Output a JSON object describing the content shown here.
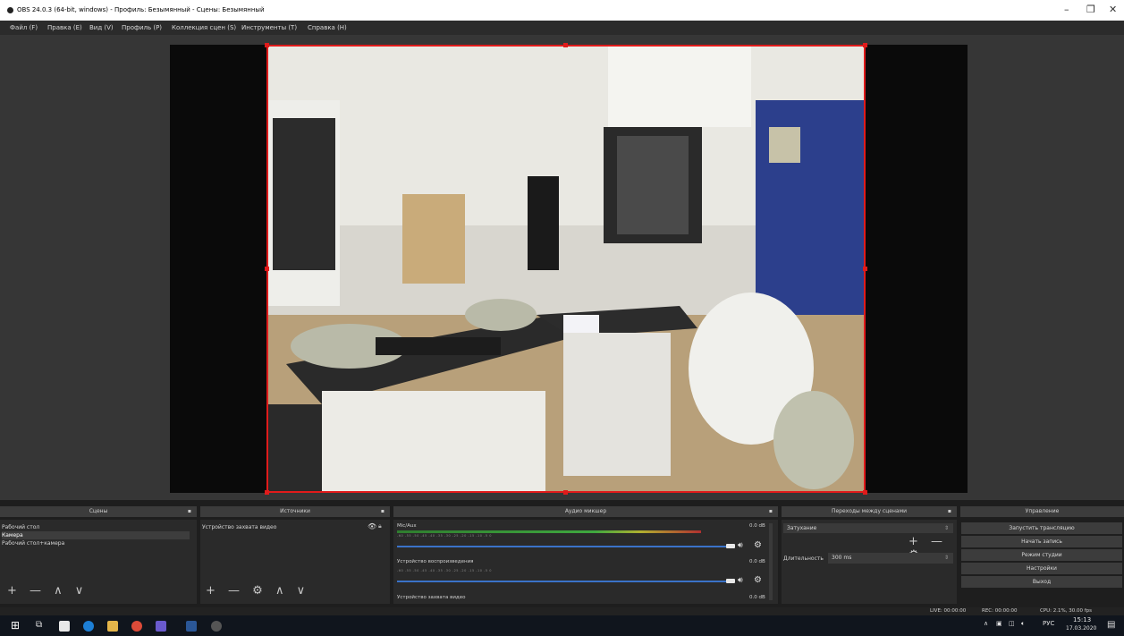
{
  "window": {
    "title": "OBS 24.0.3 (64-bit, windows) - Профиль: Безымянный - Сцены: Безымянный",
    "minimize": "–",
    "maximize": "❐",
    "close": "✕"
  },
  "menu": [
    "Файл (F)",
    "Правка (E)",
    "Вид (V)",
    "Профиль (P)",
    "Коллекция сцен (S)",
    "Инструменты (T)",
    "Справка (H)"
  ],
  "docks": {
    "scenes": {
      "title": "Сцены",
      "items": [
        "Рабочий стол",
        "Камера",
        "Рабочий стол+камера"
      ],
      "selected": 1,
      "tools": "+ — ∧ ∨"
    },
    "sources": {
      "title": "Источники",
      "items": [
        "Устройство захвата видео"
      ],
      "tools": "+ — ⚙ ∧ ∨"
    },
    "mixer": {
      "title": "Аудио микшер",
      "ticks": "-60 -55 -50 -45 -40 -35 -30 -25 -20 -15 -10 -5 0",
      "channels": [
        {
          "name": "Mic/Aux",
          "db": "0.0 dB",
          "level": 0.83
        },
        {
          "name": "Устройство воспроизведения",
          "db": "0.0 dB",
          "level": 0.0
        },
        {
          "name": "Устройство захвата видео",
          "db": "0.0 dB",
          "level": 0.0
        }
      ]
    },
    "transitions": {
      "title": "Переходы между сценами",
      "type": "Затухание",
      "duration_label": "Длительность",
      "duration": "300 ms",
      "tools": "+ — ⚙"
    },
    "controls": {
      "title": "Управление",
      "buttons": [
        "Запустить трансляцию",
        "Начать запись",
        "Режим студии",
        "Настройки",
        "Выход"
      ]
    }
  },
  "status": {
    "live": "LIVE: 00:00:00",
    "rec": "REC: 00:00:00",
    "cpu": "CPU: 2.1%, 30.00 fps"
  },
  "taskbar": {
    "lang": "РУС",
    "time": "15:13",
    "date": "17.03.2020"
  }
}
